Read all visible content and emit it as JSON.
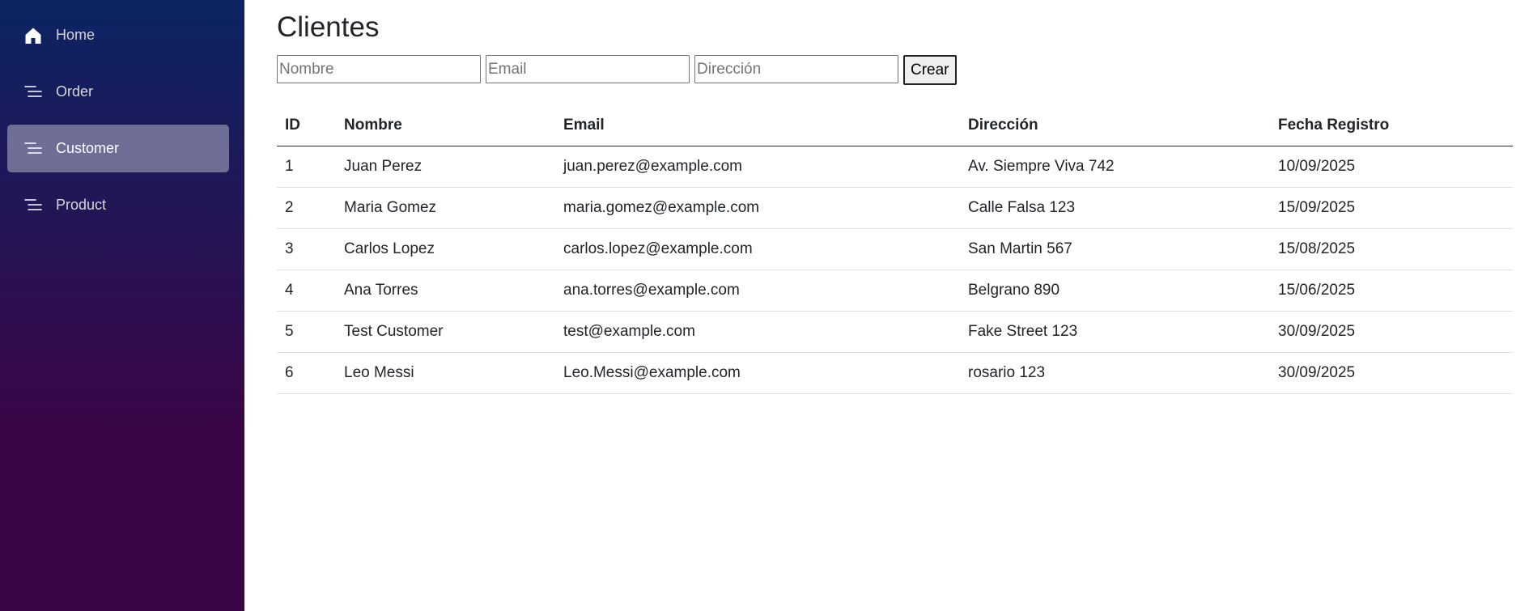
{
  "sidebar": {
    "items": [
      {
        "label": "Home",
        "icon": "home-icon",
        "active": false
      },
      {
        "label": "Order",
        "icon": "list-icon",
        "active": false
      },
      {
        "label": "Customer",
        "icon": "list-icon",
        "active": true
      },
      {
        "label": "Product",
        "icon": "list-icon",
        "active": false
      }
    ]
  },
  "page": {
    "title": "Clientes"
  },
  "form": {
    "nombre_placeholder": "Nombre",
    "email_placeholder": "Email",
    "direccion_placeholder": "Dirección",
    "create_label": "Crear"
  },
  "table": {
    "headers": [
      "ID",
      "Nombre",
      "Email",
      "Dirección",
      "Fecha Registro"
    ],
    "rows": [
      [
        "1",
        "Juan Perez",
        "juan.perez@example.com",
        "Av. Siempre Viva 742",
        "10/09/2025"
      ],
      [
        "2",
        "Maria Gomez",
        "maria.gomez@example.com",
        "Calle Falsa 123",
        "15/09/2025"
      ],
      [
        "3",
        "Carlos Lopez",
        "carlos.lopez@example.com",
        "San Martin 567",
        "15/08/2025"
      ],
      [
        "4",
        "Ana Torres",
        "ana.torres@example.com",
        "Belgrano 890",
        "15/06/2025"
      ],
      [
        "5",
        "Test Customer",
        "test@example.com",
        "Fake Street 123",
        "30/09/2025"
      ],
      [
        "6",
        "Leo Messi",
        "Leo.Messi@example.com",
        "rosario 123",
        "30/09/2025"
      ]
    ]
  },
  "colors": {
    "sidebar_top": "#0c2463",
    "sidebar_bottom": "#3a0647",
    "active_item_bg": "rgba(255,255,255,0.37)"
  }
}
